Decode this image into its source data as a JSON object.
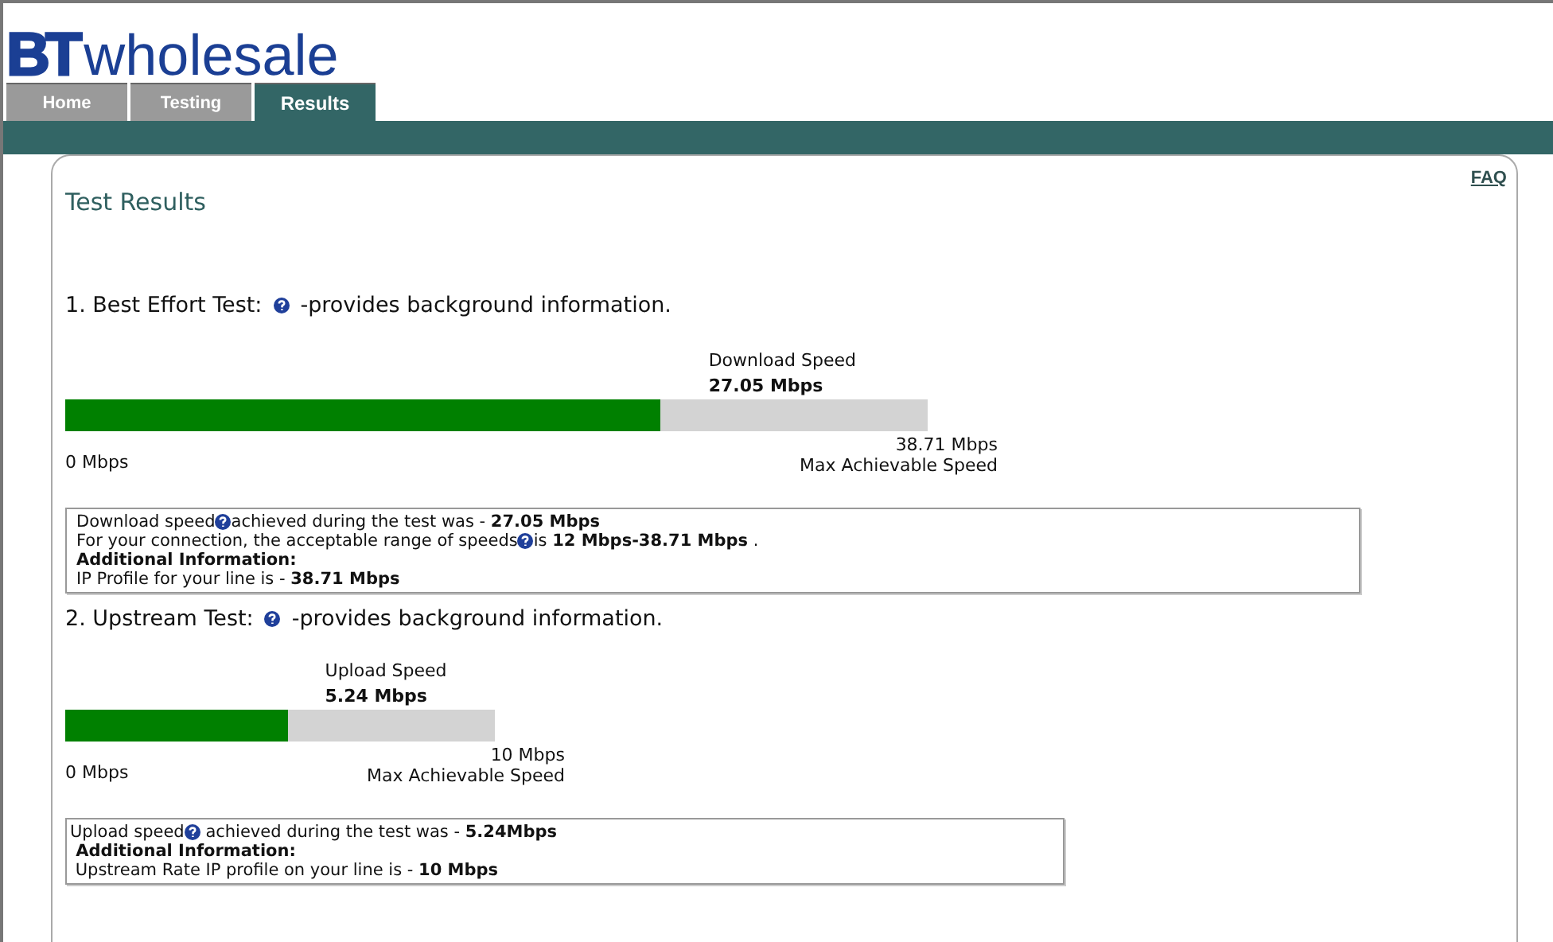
{
  "logo": {
    "mark": "BT",
    "word": "wholesale"
  },
  "tabs": [
    {
      "label": "Home",
      "selected": false
    },
    {
      "label": "Testing",
      "selected": false
    },
    {
      "label": "Results",
      "selected": true
    }
  ],
  "panel": {
    "title": "Test Results",
    "faq": "FAQ"
  },
  "tests": [
    {
      "heading": "1. Best Effort Test:",
      "heading_note": "-provides background information.",
      "speed_label": "Download Speed",
      "speed_value": "27.05 Mbps",
      "level": 0.69,
      "min_label": "0 Mbps",
      "max_value": "38.71 Mbps",
      "max_label": "Max Achievable Speed",
      "info_lines": [
        {
          "kind": "help",
          "before": "Download speed",
          "after": "achieved during the test was - **27.05 Mbps**"
        },
        {
          "kind": "help",
          "before": "For your connection, the acceptable range of speeds",
          "after": "is **12 Mbps-38.71 Mbps** ."
        },
        {
          "kind": "bold",
          "text": "Additional Information:"
        },
        {
          "kind": "plain",
          "text": "IP Profile for your line is - **38.71 Mbps**"
        }
      ]
    },
    {
      "heading": "2. Upstream Test:",
      "heading_note": "-provides background information.",
      "speed_label": "Upload Speed",
      "speed_value": "5.24 Mbps",
      "level": 0.52,
      "min_label": "0 Mbps",
      "max_value": "10 Mbps",
      "max_label": "Max Achievable Speed",
      "info_lines": [
        {
          "kind": "help",
          "before": "Upload speed",
          "after": " achieved during the test was - **5.24Mbps**"
        },
        {
          "kind": "bold",
          "text": " Additional Information:"
        },
        {
          "kind": "plain",
          "text": " Upstream Rate IP profile on your line is - **10 Mbps**"
        }
      ]
    }
  ]
}
